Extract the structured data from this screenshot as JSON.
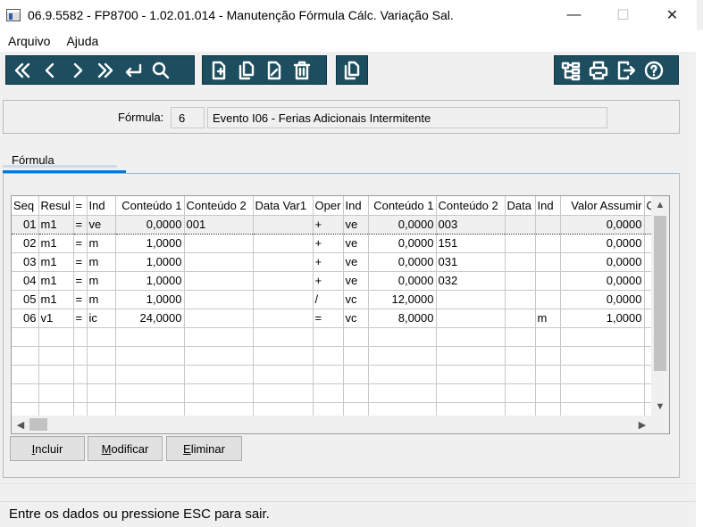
{
  "window": {
    "title": "06.9.5582 - FP8700 - 1.02.01.014 - Manutenção Fórmula Cálc. Variação Sal.",
    "minimize": "—",
    "maximize": "☐",
    "close": "✕"
  },
  "menu": [
    "Arquivo",
    "Ajuda"
  ],
  "toolbar": {
    "nav": [
      "first-icon",
      "prev-icon",
      "next-icon",
      "last-icon",
      "enter-icon",
      "search-icon"
    ],
    "edit": [
      "new-doc-icon",
      "copy-doc-icon",
      "edit-doc-icon",
      "delete-icon"
    ],
    "extra": [
      "copy-icon"
    ],
    "right": [
      "tree-icon",
      "print-icon",
      "exit-icon",
      "help-icon"
    ]
  },
  "form": {
    "label": "Fórmula:",
    "code": "6",
    "description": "Evento I06 - Ferias Adicionais Intermitente"
  },
  "tab": {
    "label": "Fórmula"
  },
  "grid": {
    "columns": [
      "Seq",
      "Resul",
      "=",
      "Ind",
      "Conteúdo 1",
      "Conteúdo 2",
      "Data Var1",
      "Oper",
      "Ind",
      "Conteúdo 1",
      "Conteúdo 2",
      "Data",
      "Ind",
      "Valor Assumir",
      "C"
    ],
    "rows": [
      [
        "01",
        "m1",
        "=",
        "ve",
        "0,0000",
        "001",
        "",
        "+",
        "ve",
        "0,0000",
        "003",
        "",
        "",
        "0,0000",
        ""
      ],
      [
        "02",
        "m1",
        "=",
        "m",
        "1,0000",
        "",
        "",
        "+",
        "ve",
        "0,0000",
        "151",
        "",
        "",
        "0,0000",
        ""
      ],
      [
        "03",
        "m1",
        "=",
        "m",
        "1,0000",
        "",
        "",
        "+",
        "ve",
        "0,0000",
        "031",
        "",
        "",
        "0,0000",
        ""
      ],
      [
        "04",
        "m1",
        "=",
        "m",
        "1,0000",
        "",
        "",
        "+",
        "ve",
        "0,0000",
        "032",
        "",
        "",
        "0,0000",
        ""
      ],
      [
        "05",
        "m1",
        "=",
        "m",
        "1,0000",
        "",
        "",
        "/",
        "vc",
        "12,0000",
        "",
        "",
        "",
        "0,0000",
        ""
      ],
      [
        "06",
        "v1",
        "=",
        "ic",
        "24,0000",
        "",
        "",
        "=",
        "vc",
        "8,0000",
        "",
        "",
        "m",
        "1,0000",
        ""
      ]
    ],
    "empty_rows": 5,
    "selected_row": 0
  },
  "buttons": {
    "include": {
      "mnemonic": "I",
      "rest": "ncluir"
    },
    "modify": {
      "mnemonic": "M",
      "rest": "odificar"
    },
    "delete": {
      "mnemonic": "E",
      "rest": "liminar"
    }
  },
  "status": "Entre os dados ou pressione ESC para sair.",
  "colors": {
    "toolbar": "#1d4e5f",
    "accent": "#0078d7"
  }
}
